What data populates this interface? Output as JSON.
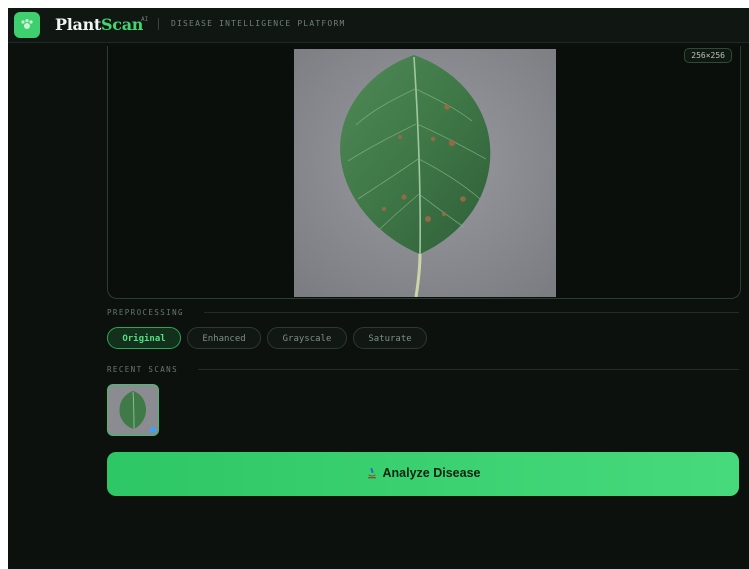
{
  "app": {
    "brand_prefix": "Plant",
    "brand_accent": "Scan",
    "brand_sup": "AI",
    "tagline": "DISEASE INTELLIGENCE PLATFORM",
    "logo_icon": "leaf-paw-icon"
  },
  "image_panel": {
    "dimension_badge": "256×256"
  },
  "preprocessing": {
    "label": "PREPROCESSING",
    "options": [
      "Original",
      "Enhanced",
      "Grayscale",
      "Saturate"
    ],
    "selected": "Original"
  },
  "recent_scans": {
    "label": "RECENT SCANS"
  },
  "analyze_button": {
    "label": "Analyze Disease",
    "icon": "microscope-icon"
  },
  "colors": {
    "accent": "#42d673",
    "background": "#0c110d",
    "button": "#3dd273"
  }
}
